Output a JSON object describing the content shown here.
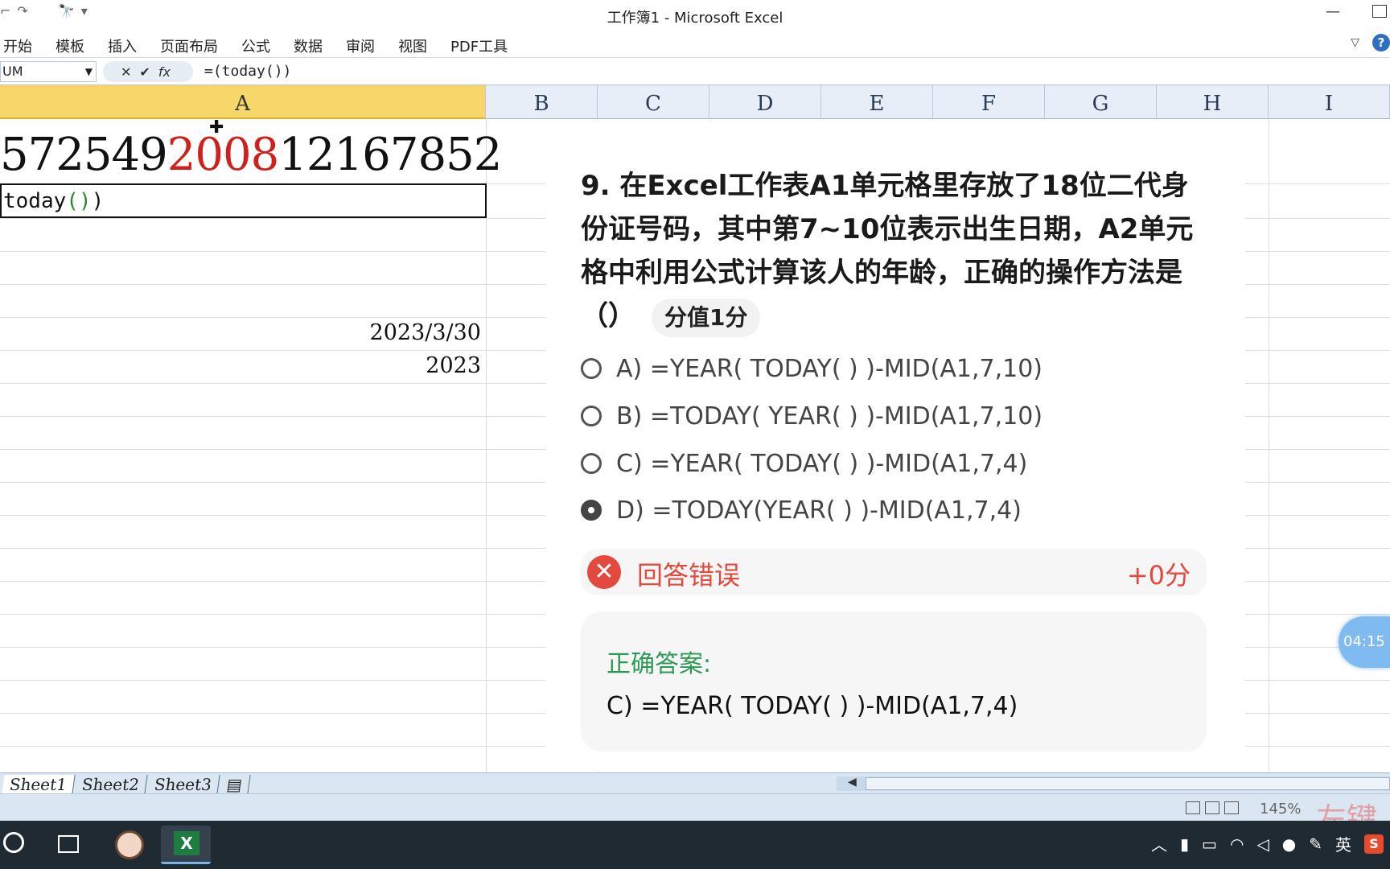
{
  "window": {
    "title": "工作簿1 - Microsoft Excel"
  },
  "ribbon": {
    "tabs": [
      "开始",
      "模板",
      "插入",
      "页面布局",
      "公式",
      "数据",
      "审阅",
      "视图",
      "PDF工具"
    ]
  },
  "formula_bar": {
    "name_box": "UM",
    "formula": "=(today())"
  },
  "columns": [
    "A",
    "B",
    "C",
    "D",
    "E",
    "F",
    "G",
    "H",
    "I"
  ],
  "cells": {
    "a1_prefix": "572549",
    "a1_highlight": "2008",
    "a1_suffix": "12167852",
    "a2_text": "today",
    "a2_parens": "()",
    "a2_close": ")",
    "a5": "2023/3/30",
    "a6": "2023"
  },
  "quiz": {
    "question": "9. 在Excel工作表A1单元格里存放了18位二代身份证号码，其中第7~10位表示出生日期，A2单元格中利用公式计算该人的年龄，正确的操作方法是（）",
    "score": "分值1分",
    "options": [
      {
        "label": "A) =YEAR( TODAY( ) )-MID(A1,7,10)",
        "selected": false
      },
      {
        "label": "B) =TODAY( YEAR( ) )-MID(A1,7,10)",
        "selected": false
      },
      {
        "label": "C) =YEAR( TODAY( ) )-MID(A1,7,4)",
        "selected": false
      },
      {
        "label": "D) =TODAY(YEAR( ) )-MID(A1,7,4)",
        "selected": true
      }
    ],
    "result_label": "回答错误",
    "result_points": "+0分",
    "correct_title": "正确答案:",
    "correct_answer": "C) =YEAR( TODAY( ) )-MID(A1,7,4)"
  },
  "timer": "04:15",
  "sheets": [
    "Sheet1",
    "Sheet2",
    "Sheet3"
  ],
  "status": {
    "zoom": "145%",
    "watermark": "左键"
  },
  "taskbar": {
    "ime": "英"
  },
  "colors": {
    "selected_col": "#f7d76a",
    "red_digits": "#d0201c",
    "wrong": "#e4493e",
    "correct": "#2b9a52"
  }
}
